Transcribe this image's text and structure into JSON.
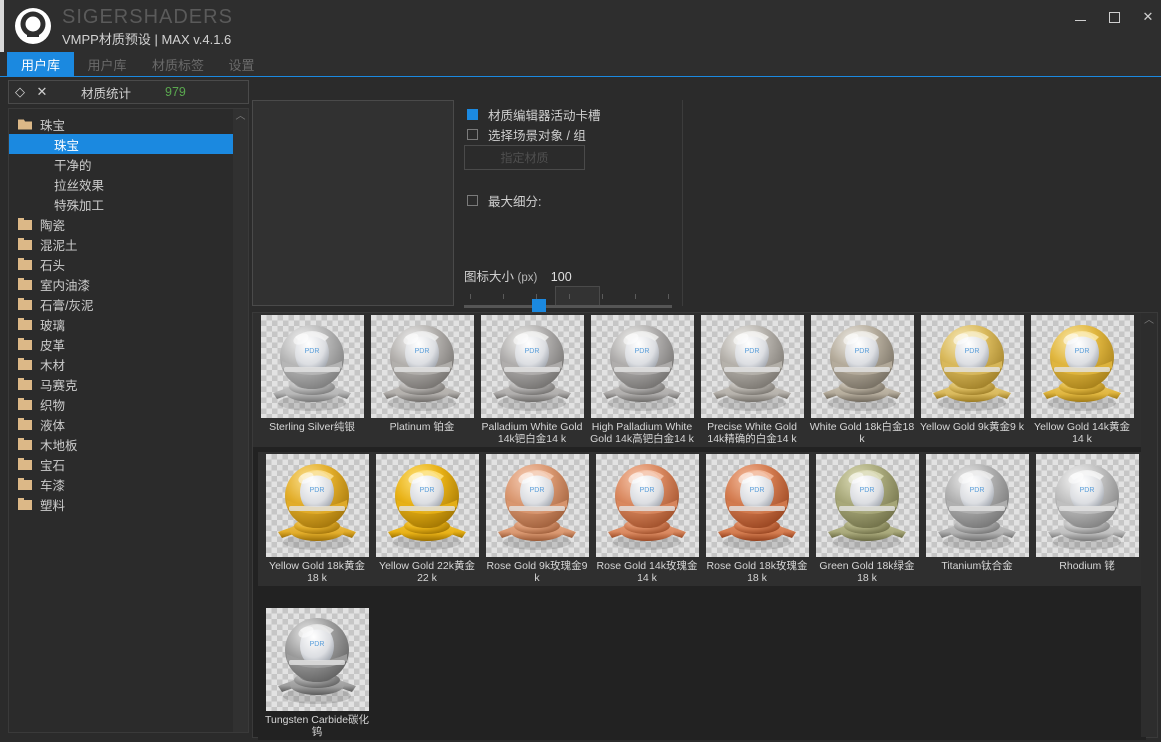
{
  "window": {
    "brand": "SIGERSHADERS",
    "subtitle": "VMPP材质预设 | MAX v.4.1.6",
    "minimize_label": "–",
    "maximize_label": "□",
    "close_label": "✕"
  },
  "tabs": [
    {
      "label": "用户库",
      "active": true
    },
    {
      "label": "用户库",
      "active": false
    },
    {
      "label": "材质标签",
      "active": false
    },
    {
      "label": "设置",
      "active": false
    }
  ],
  "stats": {
    "expand_icon": "◇",
    "collapse_icon": "✕",
    "label": "材质统计",
    "count": "979",
    "count_color": "#5aa84f"
  },
  "tree": [
    {
      "label": "珠宝",
      "type": "folder-open",
      "level": 0,
      "selected": false
    },
    {
      "label": "珠宝",
      "type": "leaf",
      "level": 1,
      "selected": true
    },
    {
      "label": "干净的",
      "type": "leaf",
      "level": 1,
      "selected": false
    },
    {
      "label": "拉丝效果",
      "type": "leaf",
      "level": 1,
      "selected": false
    },
    {
      "label": "特殊加工",
      "type": "leaf",
      "level": 1,
      "selected": false
    },
    {
      "label": "陶瓷",
      "type": "folder",
      "level": 0,
      "selected": false
    },
    {
      "label": "混泥土",
      "type": "folder",
      "level": 0,
      "selected": false
    },
    {
      "label": "石头",
      "type": "folder",
      "level": 0,
      "selected": false
    },
    {
      "label": "室内油漆",
      "type": "folder",
      "level": 0,
      "selected": false
    },
    {
      "label": "石膏/灰泥",
      "type": "folder",
      "level": 0,
      "selected": false
    },
    {
      "label": "玻璃",
      "type": "folder",
      "level": 0,
      "selected": false
    },
    {
      "label": "皮革",
      "type": "folder",
      "level": 0,
      "selected": false
    },
    {
      "label": "木材",
      "type": "folder",
      "level": 0,
      "selected": false
    },
    {
      "label": "马赛克",
      "type": "folder",
      "level": 0,
      "selected": false
    },
    {
      "label": "织物",
      "type": "folder",
      "level": 0,
      "selected": false
    },
    {
      "label": "液体",
      "type": "folder",
      "level": 0,
      "selected": false
    },
    {
      "label": "木地板",
      "type": "folder",
      "level": 0,
      "selected": false
    },
    {
      "label": "宝石",
      "type": "folder",
      "level": 0,
      "selected": false
    },
    {
      "label": "车漆",
      "type": "folder",
      "level": 0,
      "selected": false
    },
    {
      "label": "塑料",
      "type": "folder",
      "level": 0,
      "selected": false
    }
  ],
  "options": {
    "checkbox_editor_slot": {
      "label": "材质编辑器活动卡槽",
      "checked": true
    },
    "checkbox_scene_object": {
      "label": "选择场景对象 / 组",
      "checked": false
    },
    "assign_button": "指定材质",
    "checkbox_max_subdiv": {
      "label": "最大细分:",
      "checked": false
    },
    "subdiv_value": "",
    "icon_size": {
      "label": "图标大小",
      "unit": "(px)",
      "value": "100",
      "slider_min": 0,
      "slider_max": 300,
      "slider_pos_percent": 33
    }
  },
  "materials": [
    {
      "name": "Sterling Silver纯银",
      "color": "silver"
    },
    {
      "name": "Platinum 铂金",
      "color": "platinum"
    },
    {
      "name": "Palladium White Gold 14k钯白金14 k",
      "color": "palladium"
    },
    {
      "name": "High Palladium White Gold 14k高钯白金14 k",
      "color": "palladium"
    },
    {
      "name": "Precise White Gold 14k精确的白金14 k",
      "color": "whitegold"
    },
    {
      "name": "White Gold 18k白金18 k",
      "color": "whitegold2"
    },
    {
      "name": "Yellow Gold 9k黄金9 k",
      "color": "gold9"
    },
    {
      "name": "Yellow Gold 14k黄金14 k",
      "color": "gold14"
    },
    {
      "name": "Yellow Gold 18k黄金18 k",
      "color": "gold18"
    },
    {
      "name": "Yellow Gold 22k黄金22 k",
      "color": "gold22"
    },
    {
      "name": "Rose Gold 9k玫瑰金9 k",
      "color": "rose9"
    },
    {
      "name": "Rose Gold 14k玫瑰金14 k",
      "color": "rose14"
    },
    {
      "name": "Rose Gold 18k玫瑰金18 k",
      "color": "rose18"
    },
    {
      "name": "Green Gold 18k绿金18 k",
      "color": "green18"
    },
    {
      "name": "Titanium钛合金",
      "color": "titanium"
    },
    {
      "name": "Rhodium 铑",
      "color": "rhodium"
    },
    {
      "name": "Tungsten Carbide碳化钨",
      "color": "tungsten"
    }
  ],
  "scrollbars": {
    "tree_up_arrow": "︿",
    "grid_up_arrow": "︿"
  },
  "colors": {
    "accent": "#1b89e0",
    "window_bg": "#2b2b2b",
    "panel_bg": "#2f2f2f",
    "grid_bg": "#222222",
    "text": "#cfcfcf",
    "count_green": "#5aa84f",
    "folder": "#dcb887"
  }
}
